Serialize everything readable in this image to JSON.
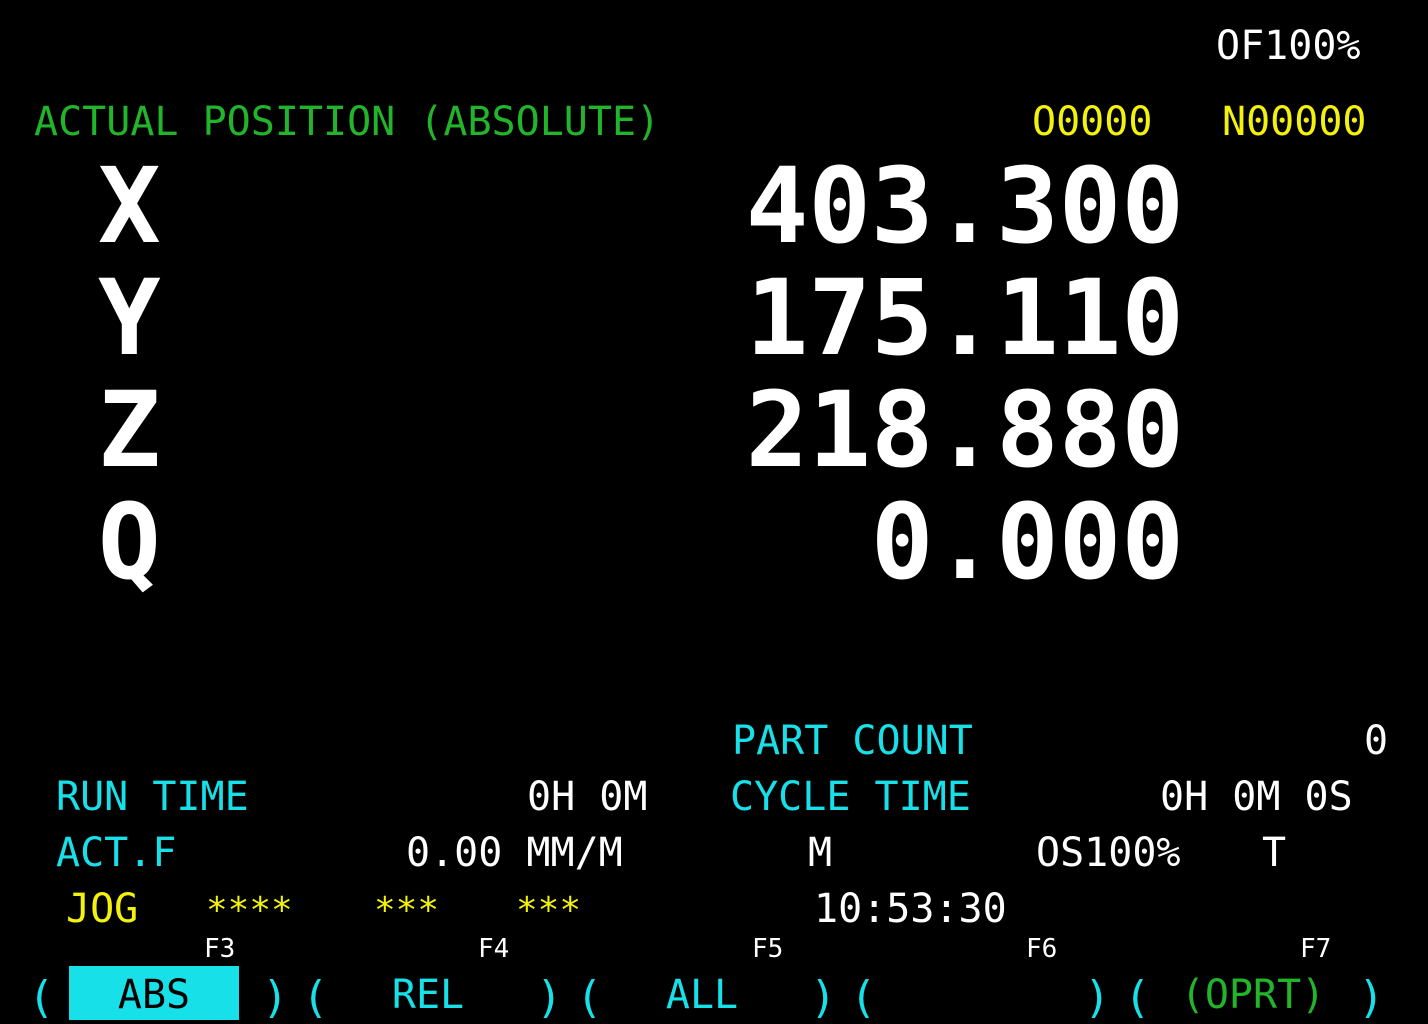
{
  "header": {
    "override": "OF100%",
    "title": "ACTUAL POSITION (ABSOLUTE)",
    "program_number": "O0000",
    "sequence_number": "N00000"
  },
  "axes": [
    {
      "name": "X",
      "value": "403.300"
    },
    {
      "name": "Y",
      "value": "175.110"
    },
    {
      "name": "Z",
      "value": "218.880"
    },
    {
      "name": "Q",
      "value": "0.000"
    }
  ],
  "status": {
    "part_count_label": "PART COUNT",
    "part_count_value": "0",
    "run_time_label": "RUN TIME",
    "run_time_value": "0H 0M",
    "cycle_time_label": "CYCLE TIME",
    "cycle_time_value": "0H 0M 0S",
    "act_f_label": "ACT.F",
    "act_f_value": "0.00 MM/M",
    "m_code": "M",
    "spindle_override": "OS100%",
    "t_code": "T",
    "mode": "JOG",
    "stars1": "****",
    "stars2": "***",
    "stars3": "***",
    "clock": "10:53:30"
  },
  "function_keys": [
    "F3",
    "F4",
    "F5",
    "F6",
    "F7"
  ],
  "softkeys": [
    {
      "label": "ABS",
      "active": true
    },
    {
      "label": "REL",
      "active": false
    },
    {
      "label": "ALL",
      "active": false
    },
    {
      "label": "",
      "active": false
    },
    {
      "label": "(OPRT)",
      "active": false
    }
  ],
  "colors": {
    "background": "#000000",
    "title_green": "#22b42a",
    "highlight_yellow": "#f2f20c",
    "label_cyan": "#17e0e8",
    "value_white": "#ffffff"
  }
}
